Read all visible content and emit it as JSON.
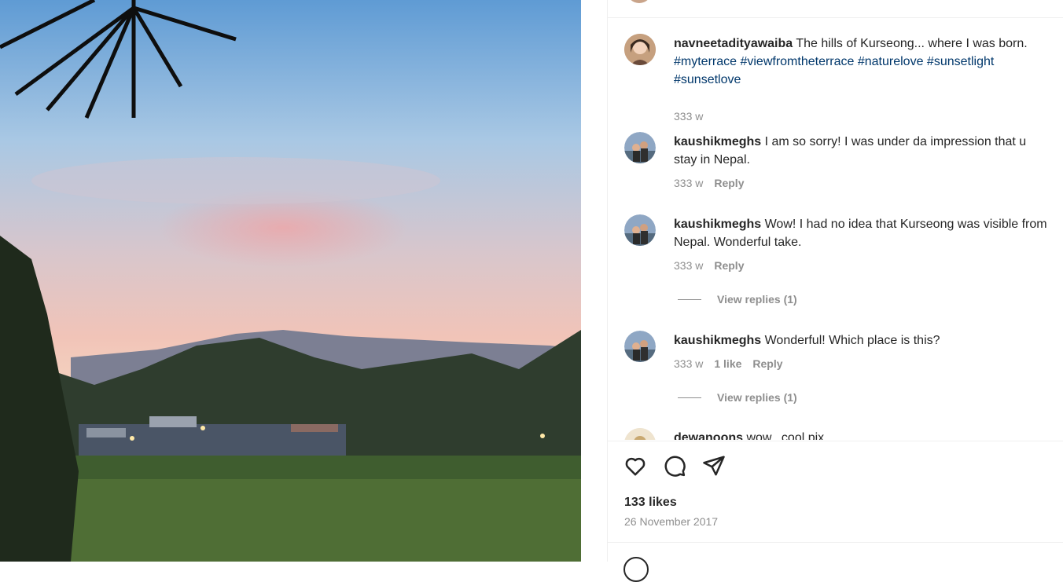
{
  "post": {
    "comments": [
      {
        "username": "navneetadityawaiba",
        "text": "The hills of Kurseong... where I was born.",
        "hashtags": "#myterrace #viewfromtheterrace #naturelove #sunsetlight #sunsetlove",
        "time": "333 w"
      },
      {
        "username": "kaushikmeghs",
        "text": "I am so sorry! I was under da impression that u stay in Nepal.",
        "time": "333 w",
        "reply": "Reply"
      },
      {
        "username": "kaushikmeghs",
        "text": "Wow! I had no idea that Kurseong was visible from Nepal. Wonderful take.",
        "time": "333 w",
        "reply": "Reply",
        "view_replies": "View replies (1)"
      },
      {
        "username": "kaushikmeghs",
        "text": "Wonderful! Which place is this?",
        "time": "333 w",
        "likes": "1 like",
        "reply": "Reply",
        "view_replies": "View replies (1)"
      },
      {
        "username": "dewanoons",
        "text": "wow.. cool pix"
      }
    ],
    "likes": "133 likes",
    "date": "26 November 2017",
    "icons": [
      "heart-icon",
      "comment-icon",
      "share-icon",
      "emoji-icon"
    ]
  }
}
